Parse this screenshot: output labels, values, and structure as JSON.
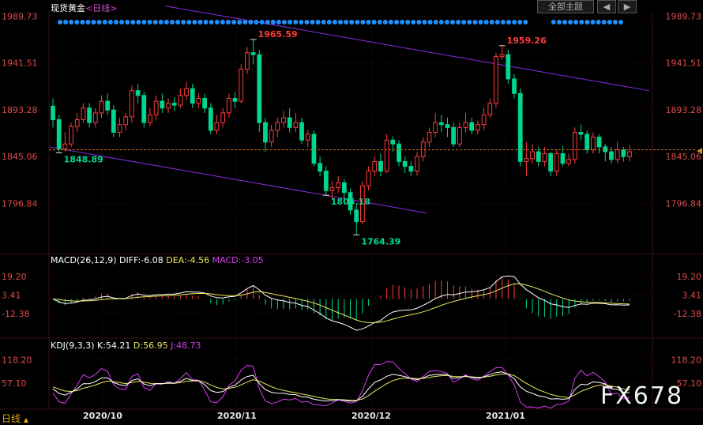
{
  "header": {
    "instrument": "现货黄金",
    "period_label": "<日线>",
    "main_button": "全部主题",
    "prev_icon": "chevron-left-icon",
    "next_icon": "chevron-right-icon",
    "period_tag": "日线",
    "period_tag_icon": "chevron-up-icon"
  },
  "watermark": "FX678",
  "colors": {
    "up": "#ff3b3b",
    "down": "#00d68f",
    "channel": "#8a2be2",
    "dots": "#1e90ff",
    "dif": "#ffffff",
    "dea": "#e8e85a",
    "kdj_k": "#ffffff",
    "kdj_d": "#e8e85a",
    "kdj_j": "#d63cf0",
    "price_axis": "#e04b4b"
  },
  "chart_data": [
    {
      "type": "candlestick",
      "title": "现货黄金 <日线>",
      "ylim": [
        1750,
        1990
      ],
      "y_ticks": [
        "1989.73",
        "1941.51",
        "1893.28",
        "1845.06",
        "1796.84"
      ],
      "x_labels": [
        "2020/10",
        "2020/11",
        "2020/12",
        "2021/01"
      ],
      "current_price_line": 1852,
      "annotations": [
        {
          "label": "1848.89",
          "value": 1848.89
        },
        {
          "label": "1965.59",
          "value": 1965.59
        },
        {
          "label": "1764.39",
          "value": 1764.39
        },
        {
          "label": "1959.26",
          "value": 1959.26
        },
        {
          "label": "1805.18",
          "value": 1805.18
        }
      ],
      "candles": [
        [
          1897,
          1883,
          1905,
          1875
        ],
        [
          1883,
          1853,
          1888,
          1848.89
        ],
        [
          1853,
          1858,
          1870,
          1850
        ],
        [
          1858,
          1876,
          1880,
          1855
        ],
        [
          1876,
          1883,
          1890,
          1870
        ],
        [
          1883,
          1895,
          1900,
          1880
        ],
        [
          1895,
          1880,
          1900,
          1875
        ],
        [
          1880,
          1890,
          1895,
          1875
        ],
        [
          1890,
          1902,
          1908,
          1885
        ],
        [
          1902,
          1893,
          1910,
          1888
        ],
        [
          1893,
          1870,
          1898,
          1865
        ],
        [
          1870,
          1878,
          1885,
          1865
        ],
        [
          1878,
          1886,
          1890,
          1872
        ],
        [
          1886,
          1913,
          1918,
          1880
        ],
        [
          1913,
          1908,
          1920,
          1900
        ],
        [
          1908,
          1880,
          1912,
          1875
        ],
        [
          1880,
          1888,
          1895,
          1876
        ],
        [
          1888,
          1902,
          1908,
          1883
        ],
        [
          1902,
          1895,
          1910,
          1890
        ],
        [
          1895,
          1900,
          1905,
          1890
        ],
        [
          1900,
          1898,
          1906,
          1892
        ],
        [
          1898,
          1908,
          1915,
          1895
        ],
        [
          1908,
          1915,
          1922,
          1903
        ],
        [
          1915,
          1900,
          1920,
          1895
        ],
        [
          1900,
          1905,
          1910,
          1895
        ],
        [
          1905,
          1895,
          1910,
          1890
        ],
        [
          1895,
          1872,
          1900,
          1868
        ],
        [
          1872,
          1880,
          1888,
          1868
        ],
        [
          1880,
          1890,
          1895,
          1875
        ],
        [
          1890,
          1905,
          1910,
          1885
        ],
        [
          1905,
          1902,
          1912,
          1895
        ],
        [
          1902,
          1935,
          1940,
          1900
        ],
        [
          1935,
          1952,
          1958,
          1930
        ],
        [
          1952,
          1950,
          1965.59,
          1940
        ],
        [
          1950,
          1880,
          1955,
          1870
        ],
        [
          1880,
          1860,
          1885,
          1850
        ],
        [
          1860,
          1872,
          1878,
          1855
        ],
        [
          1872,
          1880,
          1885,
          1865
        ],
        [
          1880,
          1885,
          1892,
          1875
        ],
        [
          1885,
          1875,
          1895,
          1870
        ],
        [
          1875,
          1880,
          1890,
          1870
        ],
        [
          1880,
          1862,
          1885,
          1858
        ],
        [
          1862,
          1868,
          1872,
          1855
        ],
        [
          1868,
          1838,
          1872,
          1835
        ],
        [
          1838,
          1830,
          1845,
          1825
        ],
        [
          1830,
          1810,
          1835,
          1805
        ],
        [
          1810,
          1813,
          1820,
          1800
        ],
        [
          1813,
          1818,
          1825,
          1808
        ],
        [
          1818,
          1808,
          1822,
          1800
        ],
        [
          1808,
          1790,
          1812,
          1785
        ],
        [
          1790,
          1778,
          1795,
          1764.39
        ],
        [
          1778,
          1815,
          1820,
          1775
        ],
        [
          1815,
          1830,
          1835,
          1810
        ],
        [
          1830,
          1840,
          1845,
          1825
        ],
        [
          1840,
          1830,
          1848,
          1825
        ],
        [
          1830,
          1862,
          1868,
          1828
        ],
        [
          1862,
          1858,
          1866,
          1850
        ],
        [
          1858,
          1840,
          1862,
          1835
        ],
        [
          1840,
          1835,
          1845,
          1828
        ],
        [
          1835,
          1830,
          1840,
          1825
        ],
        [
          1830,
          1845,
          1850,
          1825
        ],
        [
          1845,
          1860,
          1865,
          1840
        ],
        [
          1860,
          1870,
          1875,
          1855
        ],
        [
          1870,
          1880,
          1890,
          1865
        ],
        [
          1880,
          1878,
          1888,
          1870
        ],
        [
          1878,
          1875,
          1885,
          1865
        ],
        [
          1875,
          1858,
          1880,
          1855
        ],
        [
          1858,
          1875,
          1880,
          1855
        ],
        [
          1875,
          1880,
          1890,
          1870
        ],
        [
          1880,
          1872,
          1885,
          1868
        ],
        [
          1872,
          1878,
          1882,
          1868
        ],
        [
          1878,
          1888,
          1895,
          1872
        ],
        [
          1888,
          1900,
          1905,
          1885
        ],
        [
          1900,
          1948,
          1952,
          1895
        ],
        [
          1948,
          1950,
          1959.26,
          1945
        ],
        [
          1950,
          1925,
          1955,
          1920
        ],
        [
          1925,
          1910,
          1930,
          1905
        ],
        [
          1910,
          1840,
          1915,
          1835
        ],
        [
          1840,
          1843,
          1860,
          1825
        ],
        [
          1843,
          1850,
          1858,
          1838
        ],
        [
          1850,
          1840,
          1855,
          1835
        ],
        [
          1840,
          1848,
          1855,
          1835
        ],
        [
          1848,
          1830,
          1850,
          1825
        ],
        [
          1830,
          1848,
          1852,
          1825
        ],
        [
          1848,
          1838,
          1856,
          1835
        ],
        [
          1838,
          1842,
          1848,
          1835
        ],
        [
          1842,
          1870,
          1875,
          1838
        ],
        [
          1870,
          1868,
          1878,
          1862
        ],
        [
          1868,
          1852,
          1872,
          1848
        ],
        [
          1852,
          1865,
          1870,
          1848
        ],
        [
          1865,
          1855,
          1868,
          1848
        ],
        [
          1855,
          1850,
          1858,
          1840
        ],
        [
          1850,
          1842,
          1855,
          1838
        ],
        [
          1842,
          1852,
          1860,
          1838
        ],
        [
          1852,
          1845,
          1855,
          1840
        ],
        [
          1845,
          1850,
          1857,
          1840
        ]
      ]
    },
    {
      "type": "macd",
      "legend": "MACD(26,12,9)",
      "dif_label": "DIFF:-6.08",
      "dea_label": "DEA:-4.56",
      "macd_label": "MACD:-3.05",
      "ylim": [
        -28,
        26
      ],
      "y_ticks": [
        "19.20",
        "3.41",
        "-12.38"
      ]
    },
    {
      "type": "kdj",
      "legend": "KDJ(9,3,3)",
      "k_label": "K:54.21",
      "d_label": "D:56.95",
      "j_label": "J:48.73",
      "ylim": [
        -5,
        130
      ],
      "y_ticks": [
        "118.20",
        "57.10"
      ]
    }
  ]
}
